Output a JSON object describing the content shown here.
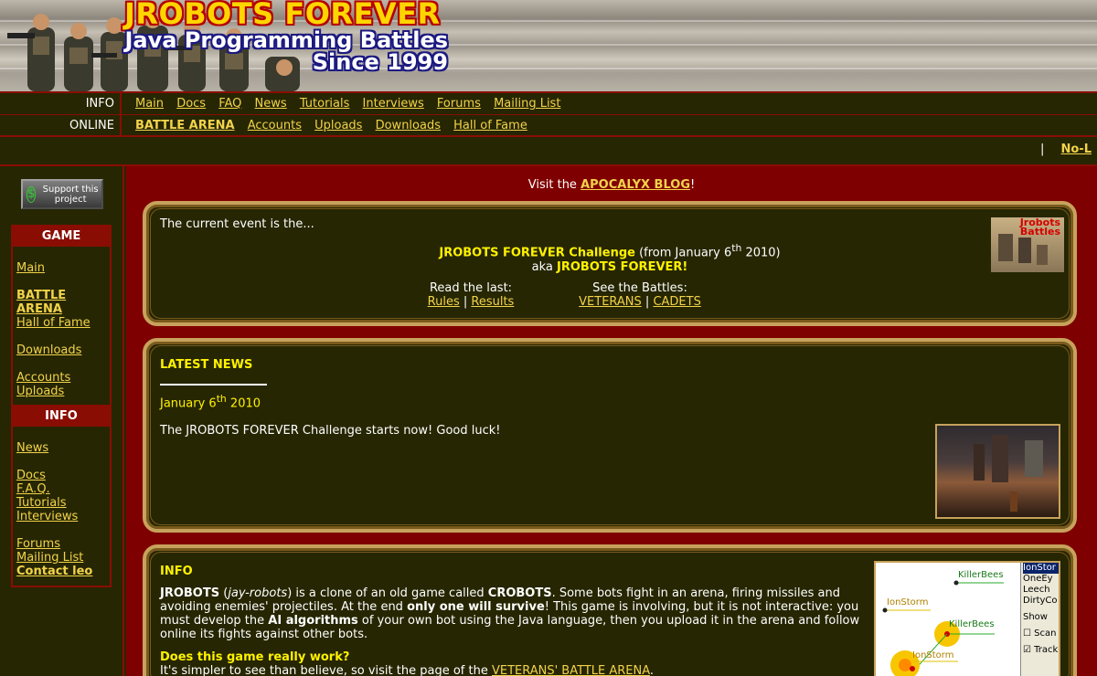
{
  "banner": {
    "title": "JROBOTS FOREVER",
    "subtitle_line1": "Java Programming Battles",
    "subtitle_line2": "Since 1999"
  },
  "nav": {
    "info_label": "INFO",
    "info_links": [
      "Main",
      "Docs",
      "FAQ",
      "News",
      "Tutorials",
      "Interviews",
      "Forums",
      "Mailing List"
    ],
    "online_label": "ONLINE",
    "online_links": [
      "BATTLE ARENA",
      "Accounts",
      "Uploads",
      "Downloads",
      "Hall of Fame"
    ],
    "pipe": "|",
    "right_link": "No-L"
  },
  "sidebar": {
    "support_label": "Support this project",
    "game_header": "GAME",
    "game_items": [
      "Main",
      "BATTLE ARENA",
      "Hall of Fame",
      "Downloads",
      "Accounts",
      "Uploads"
    ],
    "info_header": "INFO",
    "info_items": [
      "News",
      "Docs",
      "F.A.Q.",
      "Tutorials",
      "Interviews",
      "Forums",
      "Mailing List",
      "Contact leo"
    ]
  },
  "blog": {
    "prefix": "Visit the ",
    "link": "APOCALYX BLOG",
    "suffix": "!"
  },
  "event": {
    "intro": "The current event is the...",
    "title": "JROBOTS FOREVER Challenge",
    "from_prefix": " (from January 6",
    "sup": "th",
    "from_suffix": " 2010)",
    "aka": "aka ",
    "aka_name": "JROBOTS FOREVER!",
    "read_label": "Read the last:",
    "rules": "Rules",
    "results": "Results",
    "see_label": "See the Battles:",
    "veterans": "VETERANS",
    "cadets": "CADETS",
    "sep": "|",
    "thumb_text": "Jrobots Battles"
  },
  "news": {
    "title": "LATEST NEWS",
    "date_prefix": "January 6",
    "date_sup": "th",
    "date_suffix": " 2010",
    "text": "The JROBOTS FOREVER Challenge starts now! Good luck!"
  },
  "info": {
    "title": "INFO",
    "p1_a": "JROBOTS",
    "p1_b": " (",
    "p1_c": "jay-robots",
    "p1_d": ") is a clone of an old game called ",
    "p1_e": "CROBOTS",
    "p1_f": ". Some bots fight in an arena, firing missiles and avoiding enemies' projectiles. At the end ",
    "p1_g": "only one will survive",
    "p1_h": "! This game is involving, but it is not interactive: you must develop the ",
    "p1_i": "AI algorithms",
    "p1_j": " of your own bot using the Java language, then you upload it in the arena and follow online its fights against other bots.",
    "q": "Does this game really work?",
    "a_prefix": "It's simpler to see than believe, so visit the page of the ",
    "a_link": "VETERANS' BATTLE ARENA",
    "a_suffix": ".",
    "thumb_list": [
      "IonStor",
      "OneEy",
      "Leech",
      "DirtyCo"
    ],
    "thumb_show": "Show",
    "thumb_scan": "Scan",
    "thumb_track": "Track",
    "thumb_tags": [
      "KillerBees",
      "IonStorm",
      "KillerBees",
      "IonStorm"
    ]
  }
}
